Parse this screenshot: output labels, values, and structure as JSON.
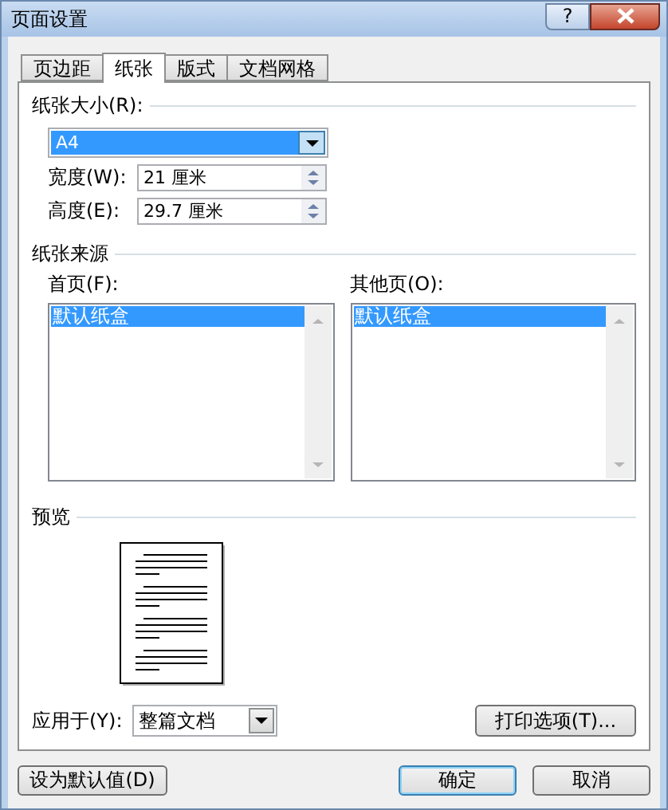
{
  "window": {
    "title": "页面设置",
    "help": "?"
  },
  "tabs": [
    {
      "label": "页边距",
      "selected": false
    },
    {
      "label": "纸张",
      "selected": true
    },
    {
      "label": "版式",
      "selected": false
    },
    {
      "label": "文档网格",
      "selected": false
    }
  ],
  "paper_size": {
    "label": "纸张大小(R):",
    "value": "A4",
    "width": {
      "label": "宽度(W):",
      "value": "21 厘米"
    },
    "height": {
      "label": "高度(E):",
      "value": "29.7 厘米"
    }
  },
  "paper_source": {
    "label": "纸张来源",
    "lists": [
      {
        "label": "首页(F):",
        "items": [
          {
            "label": "默认纸盒",
            "selected": true
          }
        ]
      },
      {
        "label": "其他页(O):",
        "items": [
          {
            "label": "默认纸盒",
            "selected": true
          }
        ]
      }
    ]
  },
  "preview": {
    "label": "预览"
  },
  "apply_to": {
    "label": "应用于(Y):",
    "value": "整篇文档"
  },
  "print_options": "打印选项(T)...",
  "buttons": [
    {
      "label": "设为默认值(D)",
      "default": false
    },
    {
      "label": "确定",
      "default": true
    },
    {
      "label": "取消",
      "default": false
    }
  ]
}
